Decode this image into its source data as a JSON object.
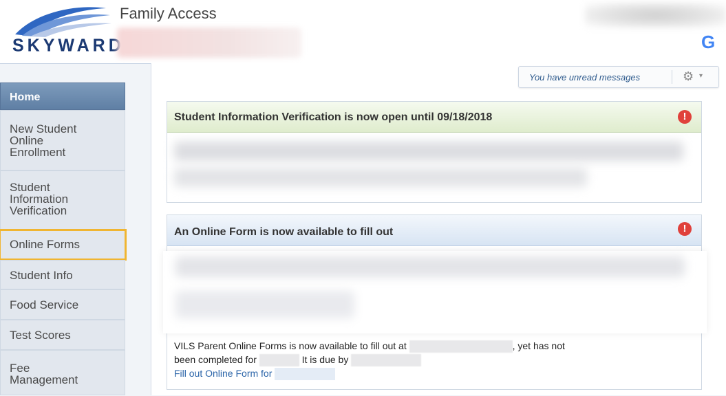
{
  "header": {
    "logo_text": "SKYWARD",
    "logo_mark": "®",
    "app_title": "Family Access",
    "google_icon_letter": "G"
  },
  "sidebar": {
    "items": [
      {
        "label": "Home",
        "active": true
      },
      {
        "label": "New Student Online Enrollment"
      },
      {
        "label": "Student Information Verification"
      },
      {
        "label": "Online Forms",
        "highlighted": true
      },
      {
        "label": "Student Info"
      },
      {
        "label": "Food Service"
      },
      {
        "label": "Test Scores"
      },
      {
        "label": "Fee Management"
      }
    ]
  },
  "messages": {
    "unread_text": "You have unread messages",
    "gear_icon": "gear-icon",
    "caret": "▾"
  },
  "panels": [
    {
      "title": "Student Information Verification is now open until 09/18/2018",
      "alert_icon": "!"
    },
    {
      "title": "An Online Form is now available to fill out",
      "alert_icon": "!",
      "body_line1_a": "VILS Parent Online Forms is now available to fill out at",
      "body_line1_b": ", yet has not",
      "body_line2_a": "been completed for",
      "body_line2_b": "It is due by",
      "link_text": "Fill out Online Form for"
    }
  ],
  "colors": {
    "accent": "#5f7fa4",
    "highlight": "#f0b531",
    "alert": "#e0413b",
    "link": "#2a64a8"
  }
}
